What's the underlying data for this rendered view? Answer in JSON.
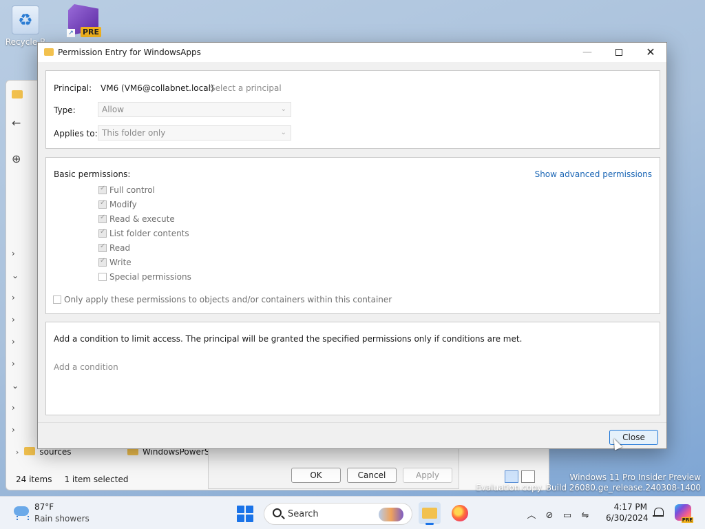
{
  "desktop": {
    "recycle_bin_label": "Recycle B",
    "vs_badge": "PRE"
  },
  "explorer": {
    "folders": [
      "sources",
      "WindowsPowerShe"
    ],
    "status_items": "24 items",
    "status_selected": "1 item selected"
  },
  "behind_dialog": {
    "ok": "OK",
    "cancel": "Cancel",
    "apply": "Apply"
  },
  "dialog": {
    "title": "Permission Entry for WindowsApps",
    "principal_label": "Principal:",
    "principal_value": "VM6 (VM6@collabnet.local)",
    "select_principal": "Select a principal",
    "type_label": "Type:",
    "type_value": "Allow",
    "applies_label": "Applies to:",
    "applies_value": "This folder only",
    "basic_permissions_label": "Basic permissions:",
    "show_advanced": "Show advanced permissions",
    "permissions": [
      {
        "label": "Full control",
        "checked": true
      },
      {
        "label": "Modify",
        "checked": true
      },
      {
        "label": "Read & execute",
        "checked": true
      },
      {
        "label": "List folder contents",
        "checked": true
      },
      {
        "label": "Read",
        "checked": true
      },
      {
        "label": "Write",
        "checked": true
      },
      {
        "label": "Special permissions",
        "checked": false
      }
    ],
    "only_apply": "Only apply these permissions to objects and/or containers within this container",
    "condition_text": "Add a condition to limit access. The principal will be granted the specified permissions only if conditions are met.",
    "add_condition": "Add a condition",
    "close_button": "Close"
  },
  "watermark": {
    "line1": "Windows 11 Pro Insider Preview",
    "line2": "Evaluation copy. Build 26080.ge_release.240308-1400"
  },
  "taskbar": {
    "temperature": "87°F",
    "weather": "Rain showers",
    "search_placeholder": "Search",
    "time": "4:17 PM",
    "date": "6/30/2024",
    "copilot_badge": "PRE"
  }
}
